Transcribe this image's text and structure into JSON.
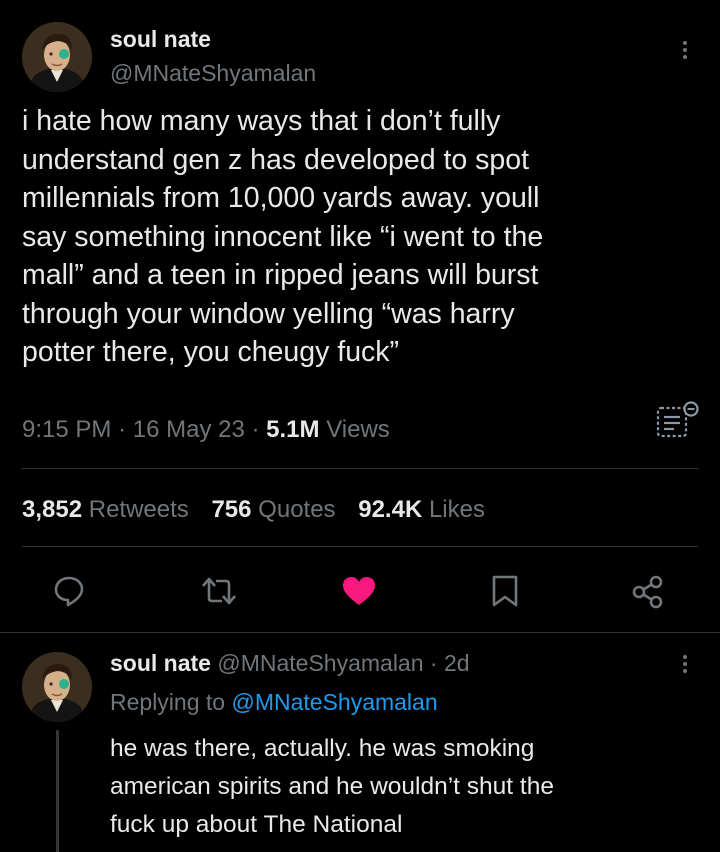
{
  "tweet": {
    "display_name": "soul nate",
    "handle": "@MNateShyamalan",
    "text_lines": [
      "i hate how many ways that i don’t fully",
      "understand gen z has developed to spot",
      "millennials from 10,000 yards away. youll",
      "say something innocent like “i went to the",
      "mall” and a teen in ripped jeans will burst",
      "through your window yelling “was harry",
      "potter there, you cheugy fuck”"
    ],
    "time": "9:15 PM",
    "date": "16 May 23",
    "separator": "·",
    "views_count": "5.1M",
    "views_label": "Views",
    "stats": {
      "retweets_count": "3,852",
      "retweets_label": "Retweets",
      "quotes_count": "756",
      "quotes_label": "Quotes",
      "likes_count": "92.4K",
      "likes_label": "Likes"
    },
    "liked": true,
    "like_color": "#f91880"
  },
  "reply": {
    "display_name": "soul nate",
    "handle": "@MNateShyamalan",
    "separator": "·",
    "age": "2d",
    "replying_prefix": "Replying to",
    "replying_handle": "@MNateShyamalan",
    "text_lines": [
      "he was there, actually. he was smoking",
      "american spirits and he wouldn’t shut the",
      "fuck up about The National"
    ]
  },
  "icons": {
    "more": "more-vertical-icon",
    "analytics": "analytics-icon",
    "reply": "reply-icon",
    "retweet": "retweet-icon",
    "like": "heart-icon",
    "bookmark": "bookmark-icon",
    "share": "share-icon"
  },
  "colors": {
    "background": "#000000",
    "text": "#e7e9ea",
    "muted": "#71767b",
    "link": "#1d9bf0",
    "divider": "#2f3336"
  }
}
